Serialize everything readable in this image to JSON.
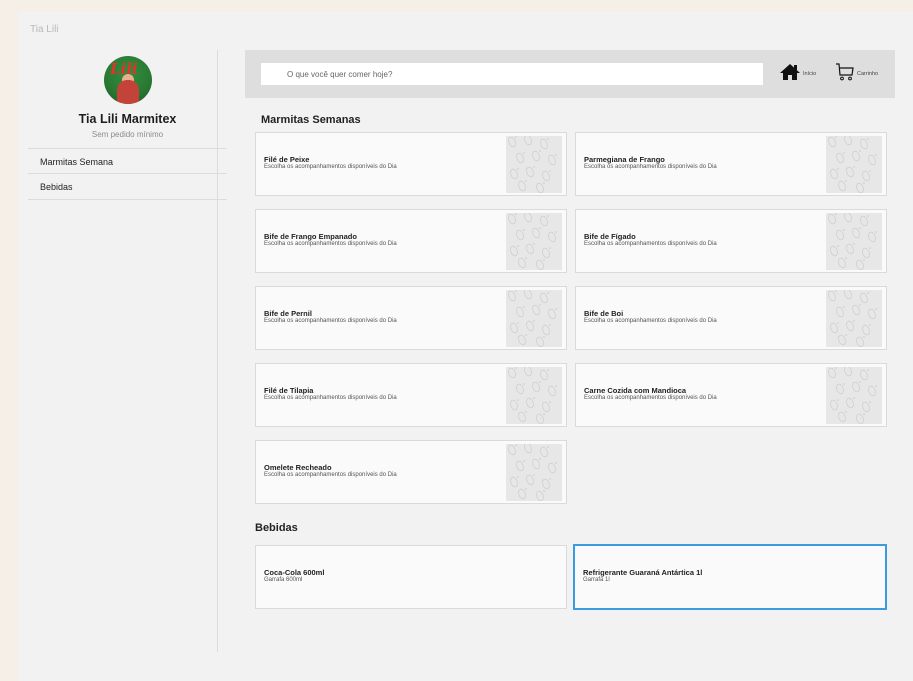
{
  "window": {
    "title": "Tia Lili"
  },
  "store": {
    "name": "Tia Lili Marmitex",
    "subtitle": "Sem pedido mínimo",
    "logo_text": "Lili"
  },
  "sidebar": {
    "items": [
      {
        "label": "Marmitas Semana"
      },
      {
        "label": "Bebidas"
      }
    ]
  },
  "header": {
    "search_placeholder": "O que você quer comer hoje?",
    "home_label": "Início",
    "cart_label": "Carrinho"
  },
  "sections": [
    {
      "title": "Marmitas Semanas",
      "items": [
        {
          "name": "Filé de Peixe",
          "desc": "Escolha os acompanhamentos disponíveis do Dia"
        },
        {
          "name": "Parmegiana de Frango",
          "desc": "Escolha os acompanhamentos disponíveis do Dia"
        },
        {
          "name": "Bife de Frango Empanado",
          "desc": "Escolha os acompanhamentos disponíveis do Dia"
        },
        {
          "name": "Bife de Fígado",
          "desc": "Escolha os acompanhamentos disponíveis do Dia"
        },
        {
          "name": "Bife de Pernil",
          "desc": "Escolha os acompanhamentos disponíveis do Dia"
        },
        {
          "name": "Bife de Boi",
          "desc": "Escolha os acompanhamentos disponíveis do Dia"
        },
        {
          "name": "Filé de Tilapia",
          "desc": "Escolha os acompanhamentos disponíveis do Dia"
        },
        {
          "name": "Carne Cozida com Mandioca",
          "desc": "Escolha os acompanhamentos disponíveis do Dia"
        },
        {
          "name": "Omelete Recheado",
          "desc": "Escolha os acompanhamentos disponíveis do Dia"
        }
      ]
    },
    {
      "title": "Bebidas",
      "items": [
        {
          "name": "Coca-Cola 600ml",
          "desc": "Garrafa 600ml"
        },
        {
          "name": "Refrigerante Guaraná Antártica 1l",
          "desc": "Garrafa 1l",
          "selected": true
        }
      ]
    }
  ],
  "colors": {
    "selected_border": "#3a9be0",
    "header_bg": "#dedede"
  }
}
